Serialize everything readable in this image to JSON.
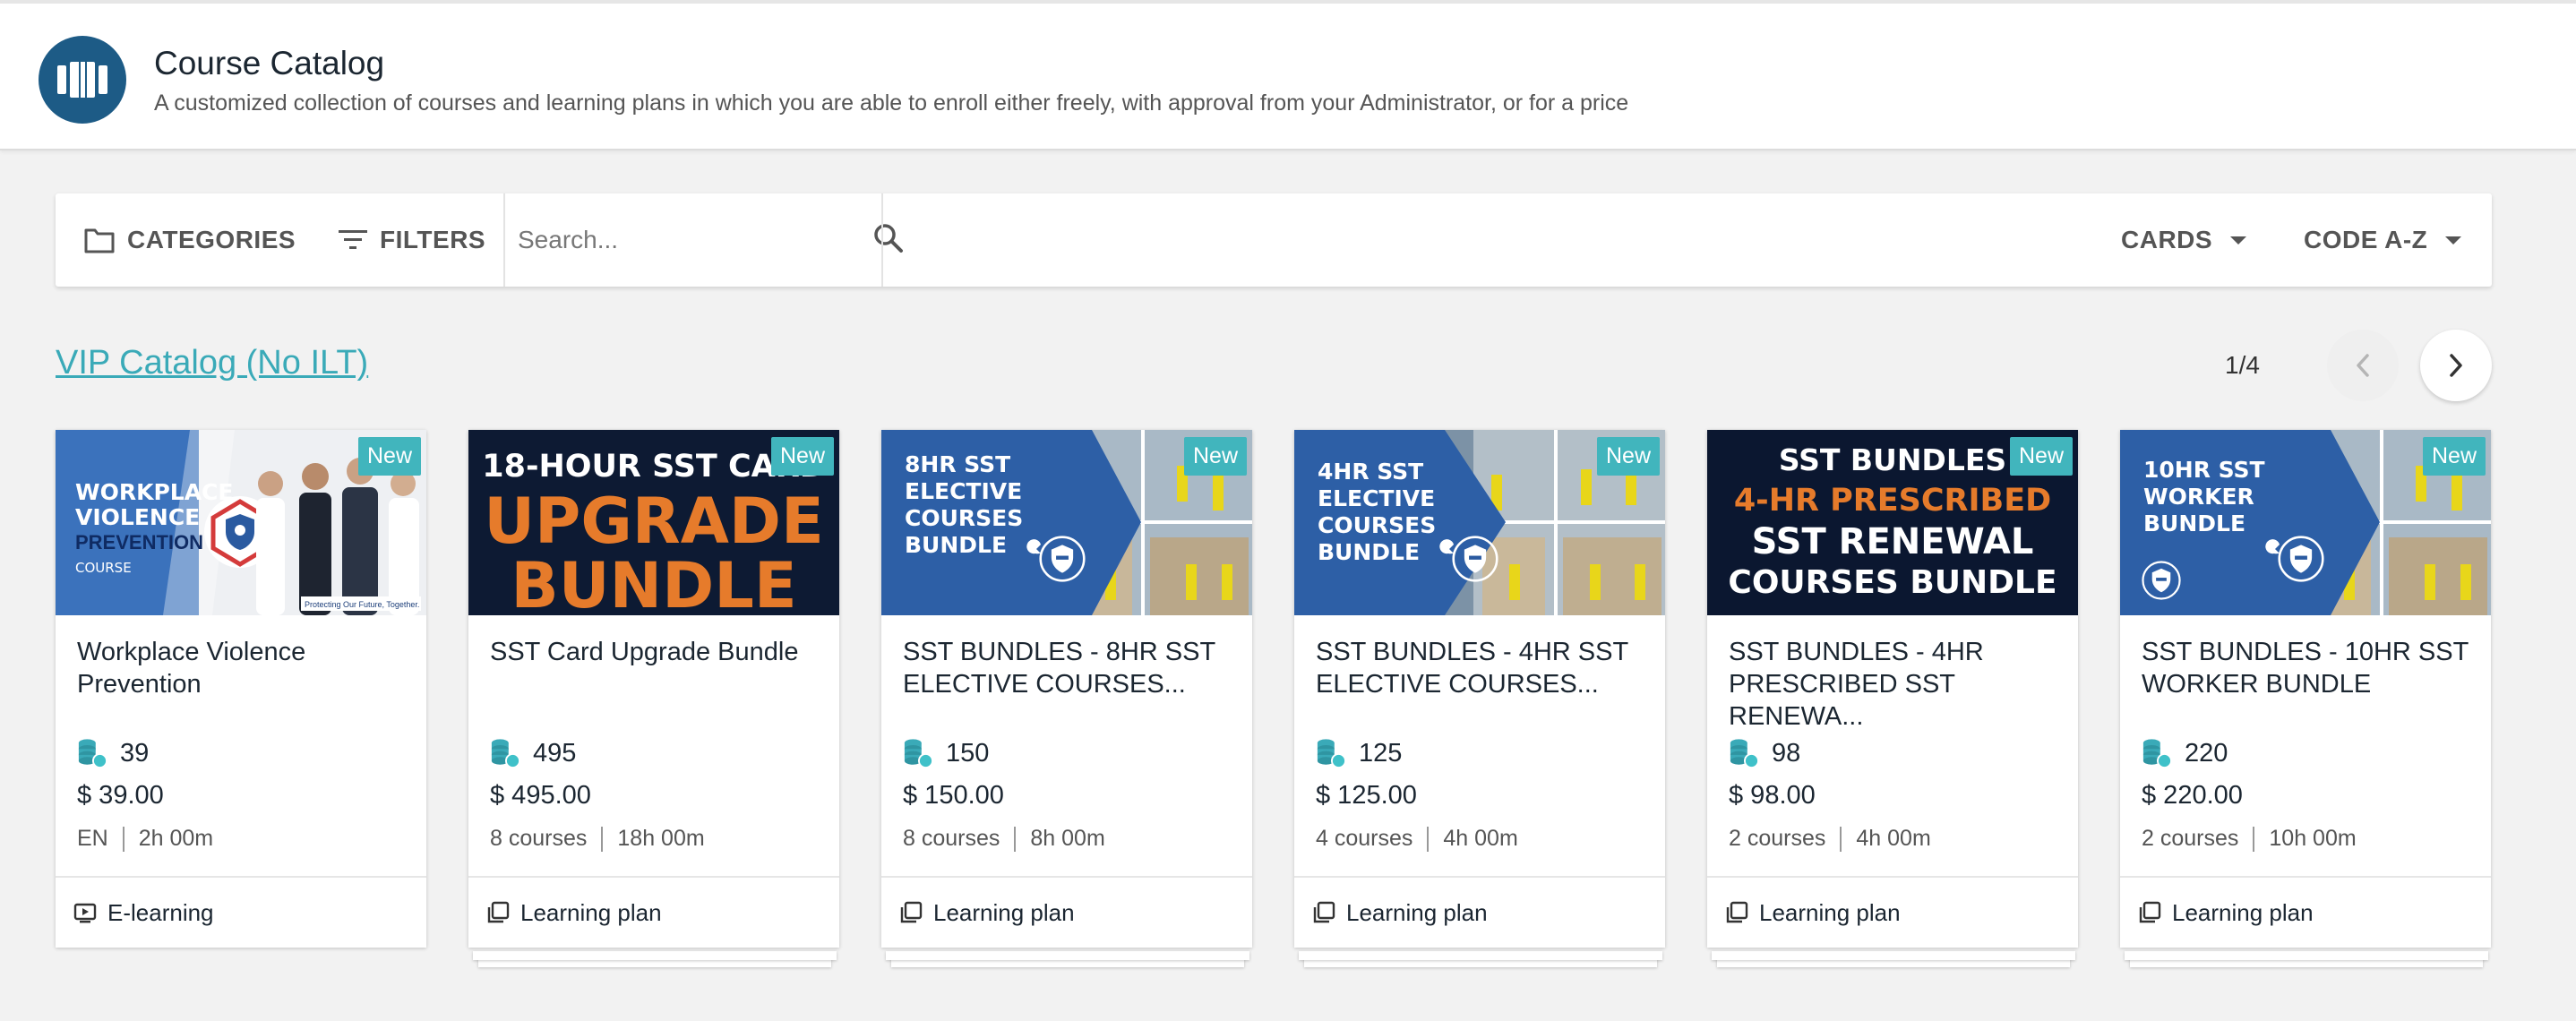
{
  "header": {
    "title": "Course Catalog",
    "description": "A customized collection of courses and learning plans in which you are able to enroll either freely, with approval from your Administrator, or for a price",
    "icon": "catalog-icon"
  },
  "toolbar": {
    "categories_label": "CATEGORIES",
    "filters_label": "FILTERS",
    "search_placeholder": "Search...",
    "search_value": "",
    "view_label": "CARDS",
    "sort_label": "CODE A-Z"
  },
  "catalog": {
    "title": "VIP Catalog (No ILT)",
    "pager": "1/4"
  },
  "colors": {
    "accent": "#3aaab8",
    "header_icon_bg": "#1d5b86",
    "badge": "#41b5bd"
  },
  "cards": [
    {
      "badge": "New",
      "title": "Workplace Violence Prevention",
      "credits": "39",
      "price": "$ 39.00",
      "meta1": "EN",
      "meta2": "2h 00m",
      "type": "E-learning",
      "thumb": {
        "lines": [
          "WORKPLACE",
          "VIOLENCE",
          "PREVENTION",
          "COURSE"
        ],
        "tagline": "Protecting Our Future, Together."
      }
    },
    {
      "badge": "New",
      "title": "SST Card Upgrade Bundle",
      "credits": "495",
      "price": "$ 495.00",
      "meta1": "8 courses",
      "meta2": "18h 00m",
      "type": "Learning plan",
      "thumb": {
        "lines": [
          "18-HOUR SST CARD",
          "UPGRADE",
          "BUNDLE"
        ]
      }
    },
    {
      "badge": "New",
      "title": "SST BUNDLES - 8HR SST ELECTIVE COURSES...",
      "credits": "150",
      "price": "$ 150.00",
      "meta1": "8 courses",
      "meta2": "8h 00m",
      "type": "Learning plan",
      "thumb": {
        "lines": [
          "8HR SST",
          "ELECTIVE",
          "COURSES",
          "BUNDLE"
        ]
      }
    },
    {
      "badge": "New",
      "title": "SST BUNDLES - 4HR SST ELECTIVE COURSES...",
      "credits": "125",
      "price": "$ 125.00",
      "meta1": "4 courses",
      "meta2": "4h 00m",
      "type": "Learning plan",
      "thumb": {
        "lines": [
          "4HR SST",
          "ELECTIVE",
          "COURSES",
          "BUNDLE"
        ]
      }
    },
    {
      "badge": "New",
      "title": "SST BUNDLES - 4HR PRESCRIBED SST RENEWA...",
      "credits": "98",
      "price": "$ 98.00",
      "meta1": "2 courses",
      "meta2": "4h 00m",
      "type": "Learning plan",
      "thumb": {
        "lines": [
          "SST BUNDLES",
          "4-HR PRESCRIBED",
          "SST RENEWAL",
          "COURSES BUNDLE"
        ]
      }
    },
    {
      "badge": "New",
      "title": "SST BUNDLES - 10HR SST WORKER BUNDLE",
      "credits": "220",
      "price": "$ 220.00",
      "meta1": "2 courses",
      "meta2": "10h 00m",
      "type": "Learning plan",
      "thumb": {
        "lines": [
          "10HR SST",
          "WORKER",
          "BUNDLE"
        ]
      }
    }
  ]
}
